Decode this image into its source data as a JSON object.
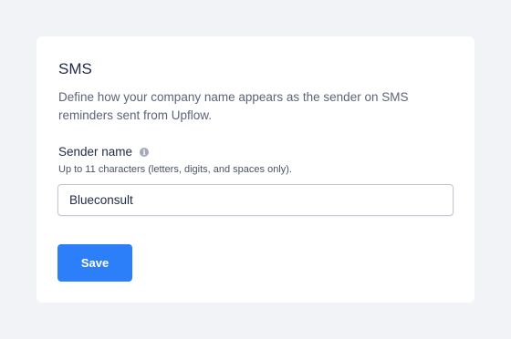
{
  "section": {
    "title": "SMS",
    "description": "Define how your company name appears as the sender on SMS reminders sent from Upflow."
  },
  "sender_field": {
    "label": "Sender name",
    "info_icon": "info-icon",
    "hint": "Up to 11 characters (letters, digits, and spaces only).",
    "value": "Blueconsult"
  },
  "actions": {
    "save_label": "Save"
  },
  "colors": {
    "background": "#f2f3f6",
    "card": "#ffffff",
    "primary_button": "#2d7ff9",
    "heading_text": "#1f2a44"
  }
}
